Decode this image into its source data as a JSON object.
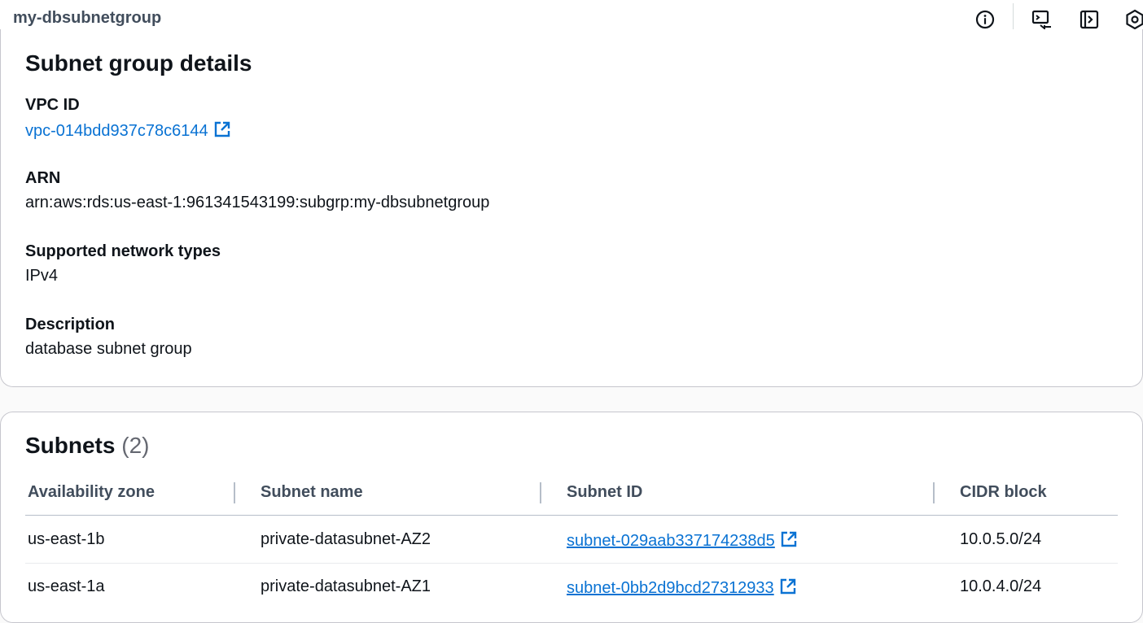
{
  "header": {
    "title": "my-dbsubnetgroup",
    "icons": [
      "info-icon",
      "feedback-icon",
      "side-panel-icon",
      "settings-hex-icon"
    ]
  },
  "details": {
    "heading": "Subnet group details",
    "vpc_label": "VPC ID",
    "vpc_value": "vpc-014bdd937c78c6144",
    "arn_label": "ARN",
    "arn_value": "arn:aws:rds:us-east-1:961341543199:subgrp:my-dbsubnetgroup",
    "network_label": "Supported network types",
    "network_value": "IPv4",
    "description_label": "Description",
    "description_value": "database subnet group"
  },
  "subnets": {
    "heading": "Subnets",
    "count": "(2)",
    "columns": [
      "Availability zone",
      "Subnet name",
      "Subnet ID",
      "CIDR block"
    ],
    "rows": [
      {
        "az": "us-east-1b",
        "name": "private-datasubnet-AZ2",
        "id": "subnet-029aab337174238d5",
        "cidr": "10.0.5.0/24"
      },
      {
        "az": "us-east-1a",
        "name": "private-datasubnet-AZ1",
        "id": "subnet-0bb2d9bcd27312933",
        "cidr": "10.0.4.0/24"
      }
    ]
  },
  "colors": {
    "link": "#0972d3",
    "text": "#0f141a",
    "muted": "#414d5c"
  }
}
